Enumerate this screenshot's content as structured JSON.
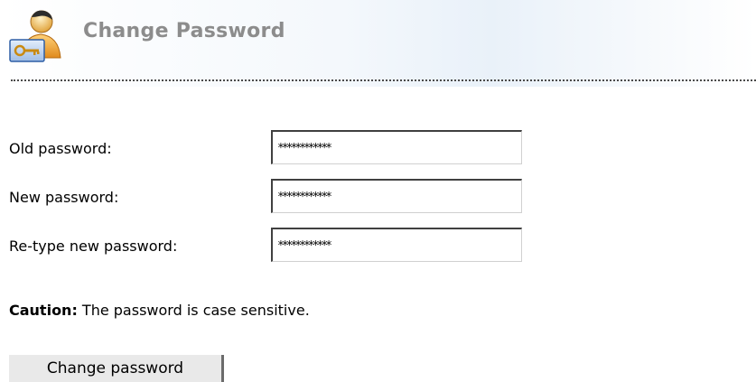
{
  "header": {
    "title": "Change Password",
    "icon": "user-key-icon"
  },
  "form": {
    "old_password": {
      "label": "Old password:",
      "value": "************"
    },
    "new_password": {
      "label": "New password:",
      "value": "************"
    },
    "retype_password": {
      "label": "Re-type new password:",
      "value": "************"
    }
  },
  "caution": {
    "label": "Caution:",
    "text": " The password is case sensitive."
  },
  "actions": {
    "submit_label": "Change password"
  },
  "colors": {
    "title": "#8c8c8c",
    "button_bg": "#e9e9e9",
    "input_border": "#404040"
  }
}
